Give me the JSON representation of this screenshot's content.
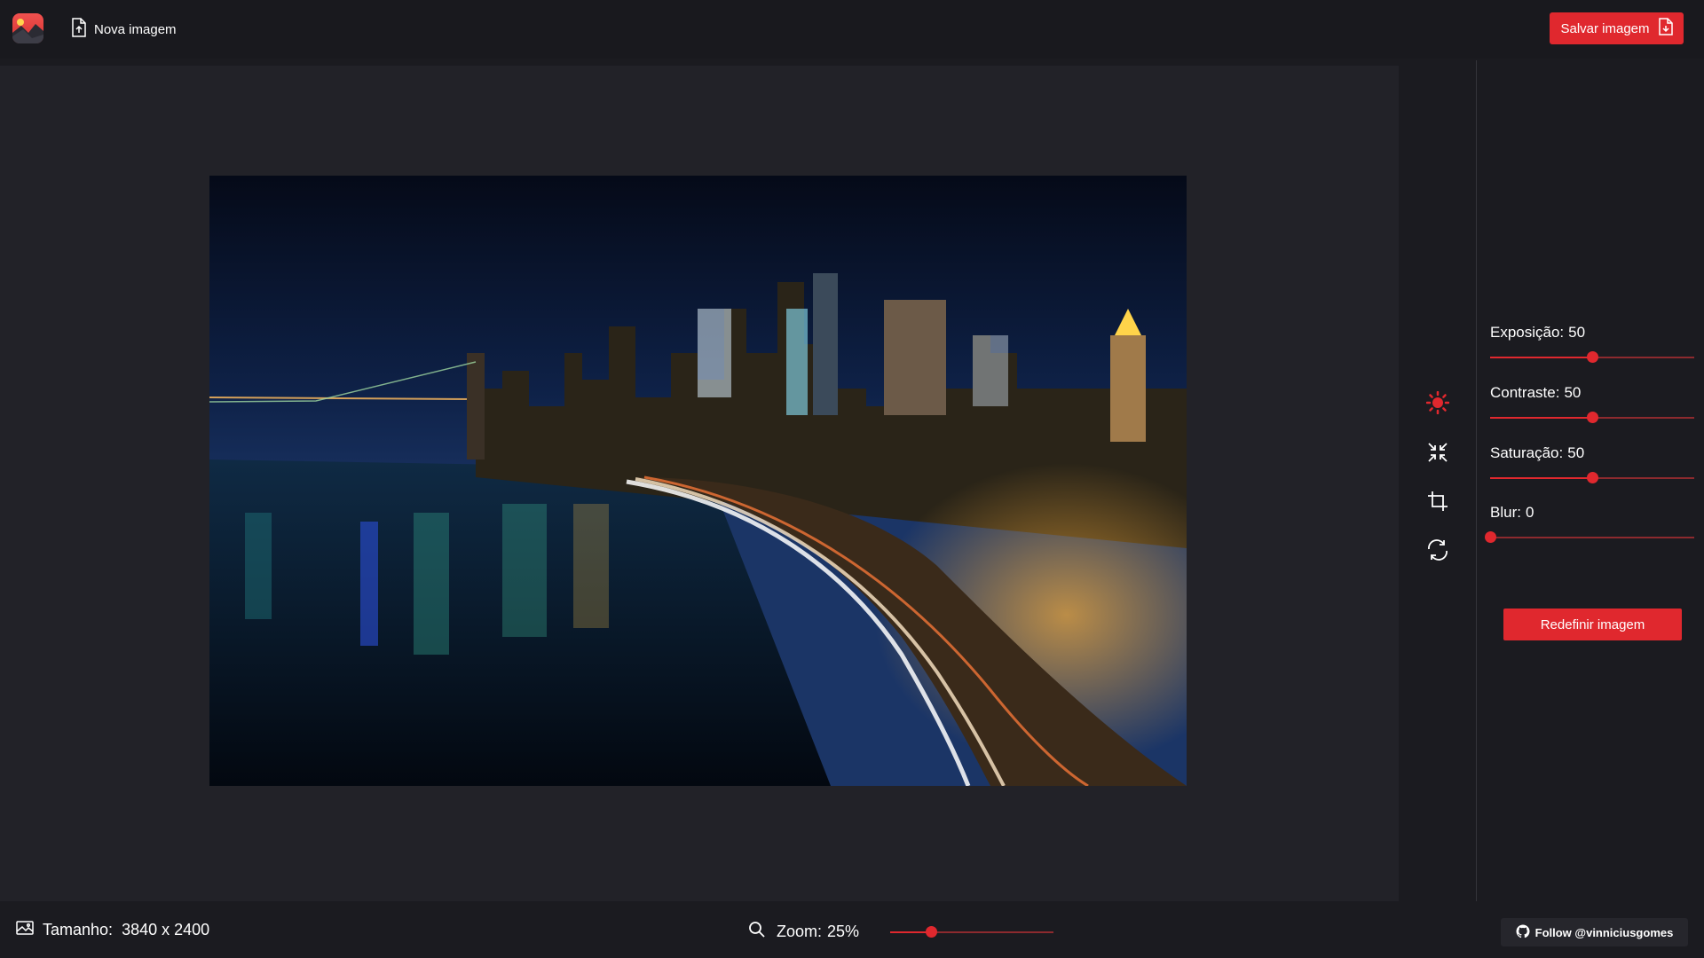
{
  "app": {
    "logo_icon": "app-logo-icon",
    "accent_color": "#e0282e"
  },
  "toolbar": {
    "new_image_label": "Nova imagem",
    "save_label": "Salvar imagem"
  },
  "tools": [
    {
      "icon": "brightness-icon",
      "active": true
    },
    {
      "icon": "compress-icon",
      "active": false
    },
    {
      "icon": "crop-icon",
      "active": false
    },
    {
      "icon": "refresh-icon",
      "active": false
    }
  ],
  "adjustments": {
    "exposure": {
      "label": "Exposição:",
      "value": "50",
      "fraction": 0.5
    },
    "contrast": {
      "label": "Contraste:",
      "value": "50",
      "fraction": 0.5
    },
    "saturation": {
      "label": "Saturação:",
      "value": "50",
      "fraction": 0.5
    },
    "blur": {
      "label": "Blur:",
      "value": "0",
      "fraction": 0.0
    }
  },
  "reset_label": "Redefinir imagem",
  "status": {
    "size_label": "Tamanho:",
    "size_value": "3840 x 2400",
    "zoom_label": "Zoom:",
    "zoom_value": "25%",
    "zoom_fraction": 0.25
  },
  "follow_label": "Follow @vinniciusgomes"
}
